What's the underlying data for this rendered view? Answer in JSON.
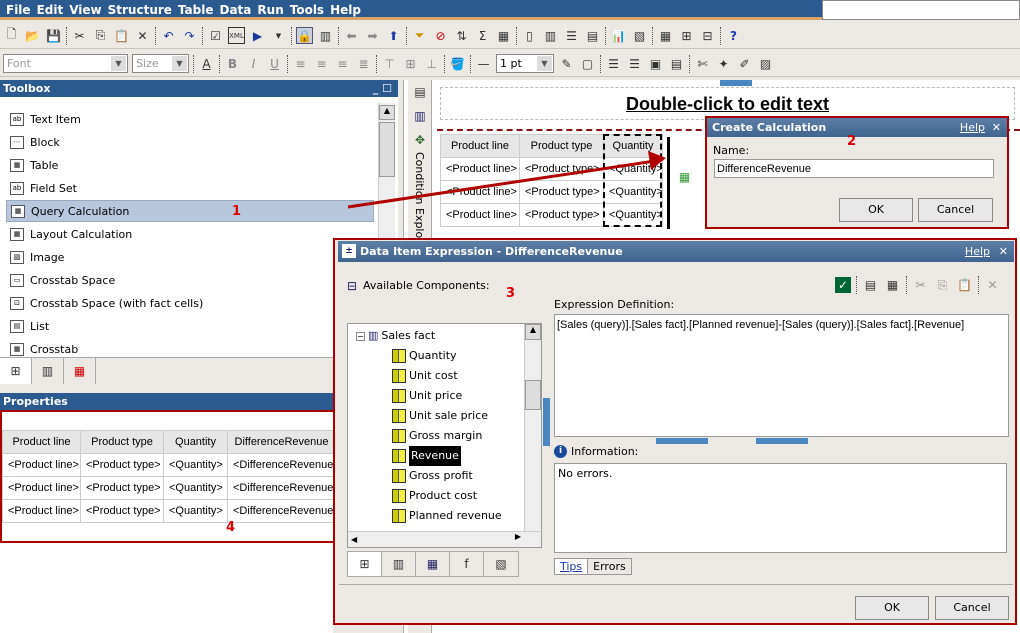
{
  "menu": [
    "File",
    "Edit",
    "View",
    "Structure",
    "Table",
    "Data",
    "Run",
    "Tools",
    "Help"
  ],
  "toolbar": {
    "font_placeholder": "Font",
    "size_placeholder": "Size",
    "line_width": "1 pt"
  },
  "toolbox": {
    "title": "Toolbox",
    "items": [
      "Text Item",
      "Block",
      "Table",
      "Field Set",
      "Query Calculation",
      "Layout Calculation",
      "Image",
      "Crosstab Space",
      "Crosstab Space (with fact cells)",
      "List",
      "Crosstab"
    ],
    "selected": "Query Calculation"
  },
  "properties": {
    "title": "Properties",
    "headers": [
      "Product line",
      "Product type",
      "Quantity",
      "DifferenceRevenue"
    ],
    "rows": [
      [
        "<Product line>",
        "<Product type>",
        "<Quantity>",
        "<DifferenceRevenue>"
      ],
      [
        "<Product line>",
        "<Product type>",
        "<Quantity>",
        "<DifferenceRevenue>"
      ],
      [
        "<Product line>",
        "<Product type>",
        "<Quantity>",
        "<DifferenceRevenue>"
      ]
    ]
  },
  "canvas": {
    "title_text": "Double-click to edit text",
    "side_label": "Condition Explorer",
    "headers": [
      "Product line",
      "Product type",
      "Quantity"
    ],
    "rows": [
      [
        "<Product line>",
        "<Product type>",
        "<Quantity>"
      ],
      [
        "<Product line>",
        "<Product type>",
        "<Quantity>"
      ],
      [
        "<Product line>",
        "<Product type>",
        "<Quantity>"
      ]
    ]
  },
  "create_calc": {
    "title": "Create Calculation",
    "help": "Help",
    "name_label": "Name:",
    "name_value": "DifferenceRevenue",
    "ok": "OK",
    "cancel": "Cancel"
  },
  "expr_dialog": {
    "title": "Data Item Expression - DifferenceRevenue",
    "help": "Help",
    "available_label": "Available Components:",
    "tree_root": "Sales fact",
    "tree_items": [
      "Quantity",
      "Unit cost",
      "Unit price",
      "Unit sale price",
      "Gross margin",
      "Revenue",
      "Gross profit",
      "Product cost",
      "Planned revenue"
    ],
    "selected": "Revenue",
    "expr_label": "Expression Definition:",
    "expression": "[Sales (query)].[Sales fact].[Planned revenue]-[Sales (query)].[Sales fact].[Revenue]",
    "info_label": "Information:",
    "info_text": "No errors.",
    "tabs": [
      "Tips",
      "Errors"
    ],
    "ok": "OK",
    "cancel": "Cancel"
  },
  "annotations": [
    "1",
    "2",
    "3",
    "4"
  ],
  "colors": {
    "titlebar": "#2b5b8e",
    "annotation": "#b00000"
  }
}
